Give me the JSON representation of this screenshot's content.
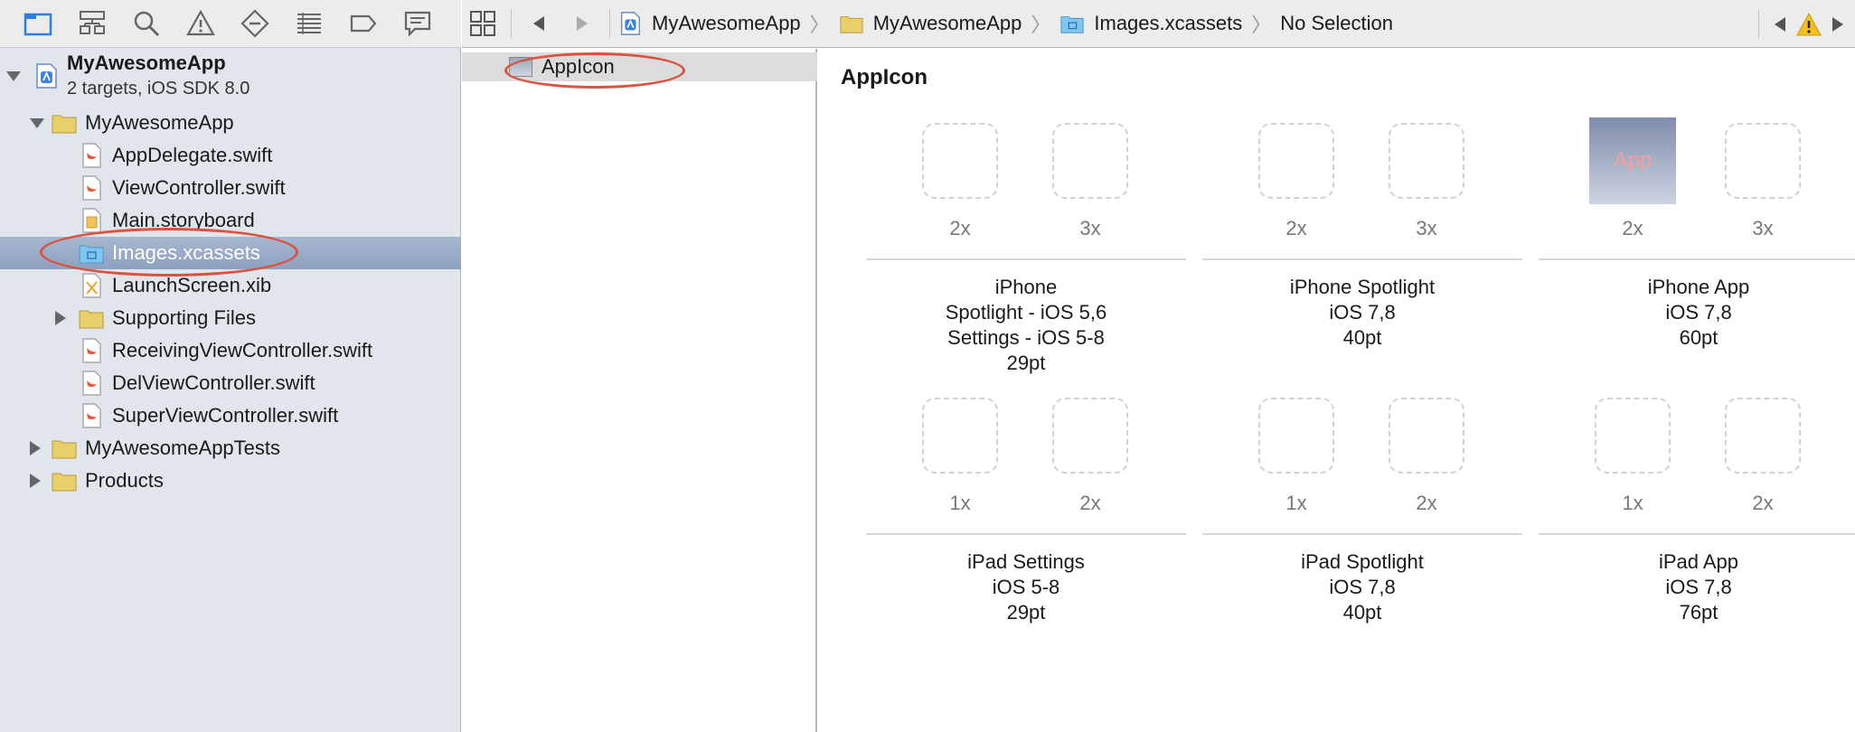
{
  "navigator": {
    "project": {
      "name": "MyAwesomeApp",
      "subtitle": "2 targets, iOS SDK 8.0"
    },
    "items": [
      {
        "label": "MyAwesomeApp",
        "kind": "folder"
      },
      {
        "label": "AppDelegate.swift",
        "kind": "swift"
      },
      {
        "label": "ViewController.swift",
        "kind": "swift"
      },
      {
        "label": "Main.storyboard",
        "kind": "storyboard"
      },
      {
        "label": "Images.xcassets",
        "kind": "xcassets"
      },
      {
        "label": "LaunchScreen.xib",
        "kind": "xib"
      },
      {
        "label": "Supporting Files",
        "kind": "folder"
      },
      {
        "label": "ReceivingViewController.swift",
        "kind": "swift"
      },
      {
        "label": "DelViewController.swift",
        "kind": "swift"
      },
      {
        "label": "SuperViewController.swift",
        "kind": "swift"
      },
      {
        "label": "MyAwesomeAppTests",
        "kind": "folder"
      },
      {
        "label": "Products",
        "kind": "folder"
      }
    ]
  },
  "jumpbar": {
    "crumbs": [
      "MyAwesomeApp",
      "MyAwesomeApp",
      "Images.xcassets",
      "No Selection"
    ]
  },
  "assets": {
    "items": [
      {
        "label": "AppIcon"
      }
    ]
  },
  "editor": {
    "title": "AppIcon",
    "groups": [
      {
        "slots": [
          "2x",
          "3x"
        ],
        "caption": [
          "iPhone",
          "Spotlight - iOS 5,6",
          "Settings - iOS 5-8",
          "29pt"
        ]
      },
      {
        "slots": [
          "2x",
          "3x"
        ],
        "caption": [
          "iPhone Spotlight",
          "iOS 7,8",
          "40pt"
        ]
      },
      {
        "slots": [
          "2x",
          "3x"
        ],
        "caption": [
          "iPhone App",
          "iOS 7,8",
          "60pt"
        ],
        "filled_slot_text": "App"
      },
      {
        "slots": [
          "1x",
          "2x"
        ],
        "caption": [
          "iPad Settings",
          "iOS 5-8",
          "29pt"
        ]
      },
      {
        "slots": [
          "1x",
          "2x"
        ],
        "caption": [
          "iPad Spotlight",
          "iOS 7,8",
          "40pt"
        ]
      },
      {
        "slots": [
          "1x",
          "2x"
        ],
        "caption": [
          "iPad App",
          "iOS 7,8",
          "76pt"
        ]
      }
    ]
  },
  "colors": {
    "selection": "#8da1c0",
    "annotation": "#d9533f",
    "folder": "#e9cf6a",
    "warning": "#f4c020"
  }
}
